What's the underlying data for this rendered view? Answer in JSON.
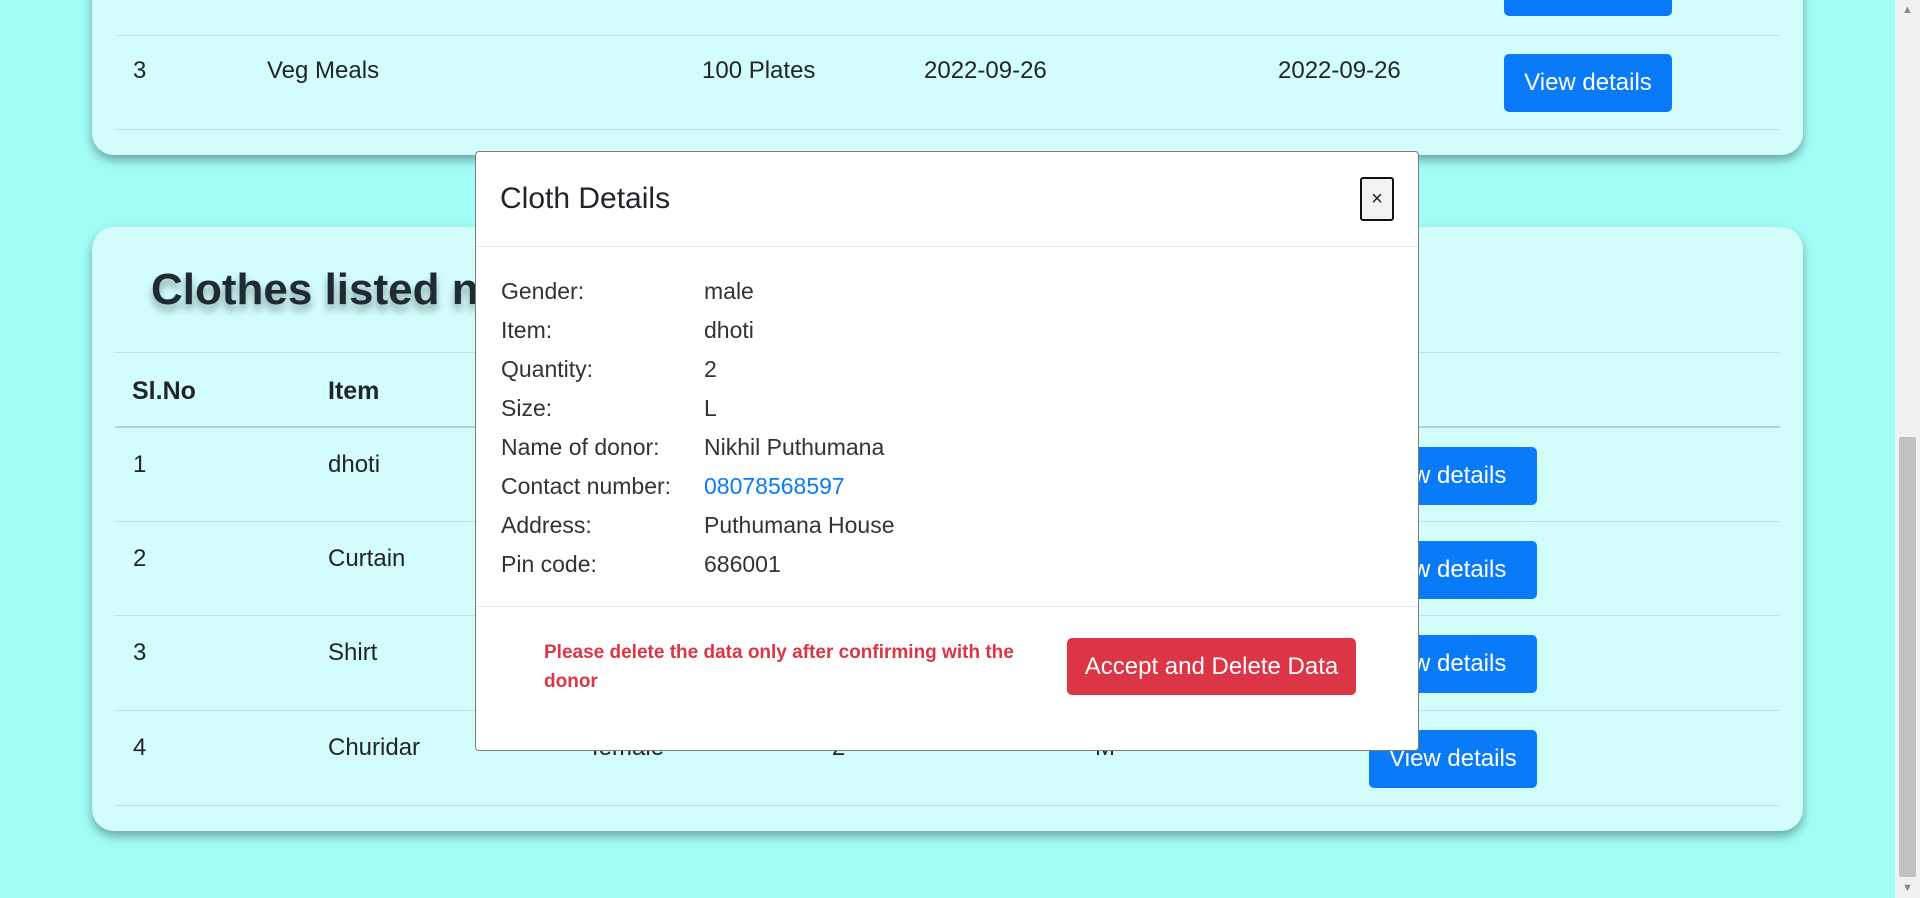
{
  "food_table": {
    "rows": [
      {
        "sl": "3",
        "item": "Veg Meals",
        "quantity": "100 Plates",
        "date1": "2022-09-26",
        "date2": "2022-09-26",
        "button": "View details"
      }
    ]
  },
  "clothes": {
    "heading": "Clothes listed ne",
    "headers": {
      "sl": "Sl.No",
      "item": "Item"
    },
    "rows": [
      {
        "sl": "1",
        "item": "dhoti",
        "gender": "",
        "quantity": "",
        "size": "",
        "button": "ew details"
      },
      {
        "sl": "2",
        "item": "Curtain",
        "gender": "",
        "quantity": "",
        "size": "",
        "button": "ew details"
      },
      {
        "sl": "3",
        "item": "Shirt",
        "gender": "",
        "quantity": "",
        "size": "",
        "button": "ew details"
      },
      {
        "sl": "4",
        "item": "Churidar",
        "gender": "female",
        "quantity": "2",
        "size": "M",
        "button": "View details"
      }
    ]
  },
  "modal": {
    "title": "Cloth Details",
    "close": "×",
    "details": [
      {
        "label": "Gender:",
        "value": "male"
      },
      {
        "label": "Item:",
        "value": "dhoti"
      },
      {
        "label": "Quantity:",
        "value": "2"
      },
      {
        "label": "Size:",
        "value": "L"
      },
      {
        "label": "Name of donor:",
        "value": "Nikhil Puthumana"
      },
      {
        "label": "Contact number:",
        "value": "08078568597"
      },
      {
        "label": "Address:",
        "value": "Puthumana House"
      },
      {
        "label": "Pin code:",
        "value": "686001"
      }
    ],
    "warning": "Please delete the data only after confirming with the donor",
    "accept_button": "Accept and Delete Data"
  },
  "scrollbar": {
    "up_icon": "scroll-up-arrow",
    "down_icon": "scroll-down-arrow"
  }
}
